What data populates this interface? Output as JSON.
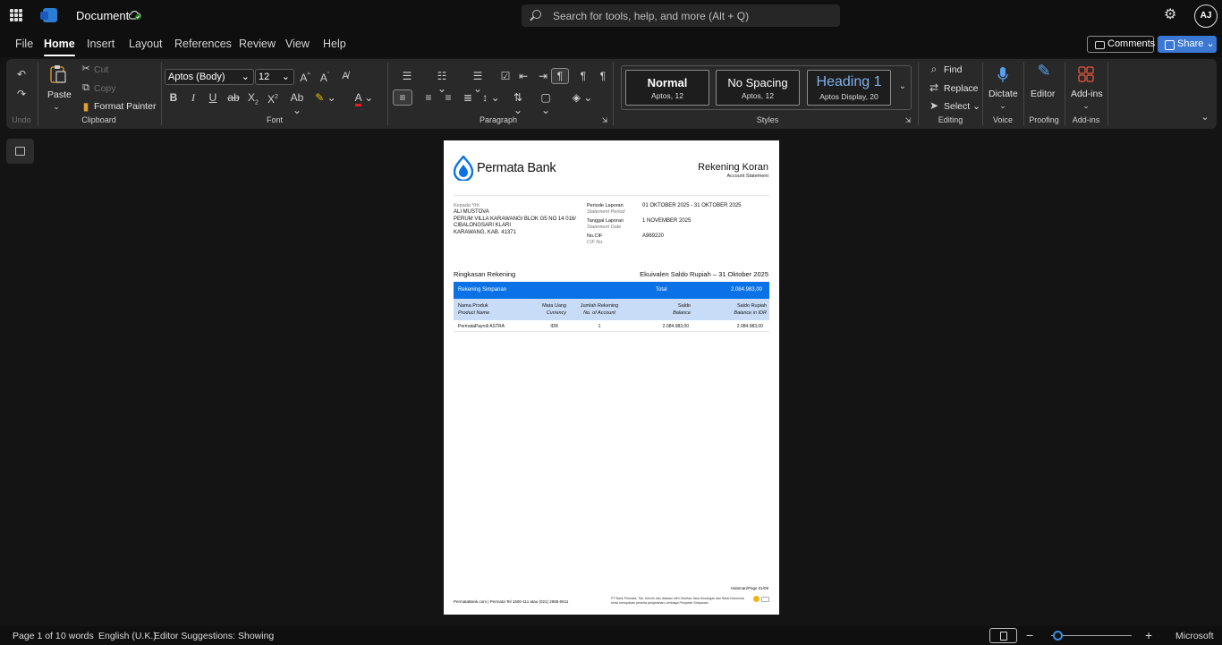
{
  "app": {
    "title": "Document",
    "search_placeholder": "Search for tools, help, and more (Alt + Q)",
    "avatar_initials": "AJ",
    "accent": "#3b78d4"
  },
  "menu": {
    "tabs": [
      "File",
      "Home",
      "Insert",
      "Layout",
      "References",
      "Review",
      "View",
      "Help"
    ],
    "active_tab": "Home",
    "comments_label": "Comments",
    "share_label": "Share"
  },
  "ribbon": {
    "undo": {
      "label": "Undo"
    },
    "clipboard": {
      "paste": "Paste",
      "cut": "Cut",
      "copy": "Copy",
      "format_painter": "Format Painter",
      "label": "Clipboard"
    },
    "font": {
      "font_name": "Aptos (Body)",
      "font_size": "12",
      "label": "Font"
    },
    "paragraph": {
      "label": "Paragraph"
    },
    "styles": {
      "label": "Styles",
      "items": [
        {
          "name": "Normal",
          "sub": "Aptos, 12"
        },
        {
          "name": "No Spacing",
          "sub": "Aptos, 12"
        },
        {
          "name": "Heading 1",
          "sub": "Aptos Display, 20"
        }
      ]
    },
    "editing": {
      "find": "Find",
      "replace": "Replace",
      "select": "Select",
      "label": "Editing"
    },
    "voice": {
      "dictate": "Dictate",
      "label": "Voice"
    },
    "proofing": {
      "editor": "Editor",
      "label": "Proofing"
    },
    "addins": {
      "addins": "Add-ins",
      "label": "Add-ins"
    }
  },
  "document": {
    "bank_name": "Permata Bank",
    "doc_title": "Rekening Koran",
    "doc_subtitle": "Account Statement",
    "to_label": "Kepada Yth",
    "customer_name": "ALI MUSTOVA",
    "address": [
      "PERUM VILLA KARAWANGI BLOK G5 NO 14 016/",
      "CIBALONGSARI KLARI",
      "KARAWANG, KAB. 41371"
    ],
    "period_label": "Periode Laporan",
    "period_label_en": "Statement Period",
    "period_value": "01 OKTOBER 2025 - 31 OKTOBER 2025",
    "date_label": "Tanggal Laporan",
    "date_label_en": "Statement Date",
    "date_value": "1 NOVEMBER 2025",
    "cif_label": "No.CIF",
    "cif_label_en": "CIF No.",
    "cif_value": "A969220",
    "summary_title": "Ringkasan Rekening",
    "summary_right": "Ekuivalen Saldo Rupiah – 31 Oktober 2025",
    "band_label": "Rekening Simpanan",
    "band_total_label": "Total",
    "band_total_value": "2.084.983,00",
    "columns": [
      {
        "id": "Nama Produk",
        "en": "Product Name"
      },
      {
        "id": "Mata Uang",
        "en": "Currency"
      },
      {
        "id": "Jumlah Rekening",
        "en": "No. of Account"
      },
      {
        "id": "Saldo",
        "en": "Balance"
      },
      {
        "id": "Saldo Rupiah",
        "en": "Balance in IDR"
      }
    ],
    "rows": [
      [
        "PermataPayroll ASTRA",
        "IDR",
        "1",
        "2.084.983,00",
        "2.084.983,00"
      ]
    ],
    "page_label": "Halaman/Page 01/09",
    "footer_left": "PermataBank.com | Permata Tel 1500-111 atau (021) 2985-0611",
    "footer_right": [
      "PT Bank Permata, Tbk. berizin dan diawasi oleh Otoritas Jasa Keuangan dan Bank Indonesia",
      "serta merupakan peserta penjaminan Lembaga Penjamin Simpanan"
    ],
    "brand_blue": "#0a72e6",
    "header_blue": "#c9dcf7"
  },
  "status": {
    "page": "Page 1 of 1",
    "words": "0 words",
    "language": "English (U.K.)",
    "editor": "Editor Suggestions: Showing",
    "brand": "Microsoft",
    "zoom_minus": "−",
    "zoom_plus": "+"
  }
}
